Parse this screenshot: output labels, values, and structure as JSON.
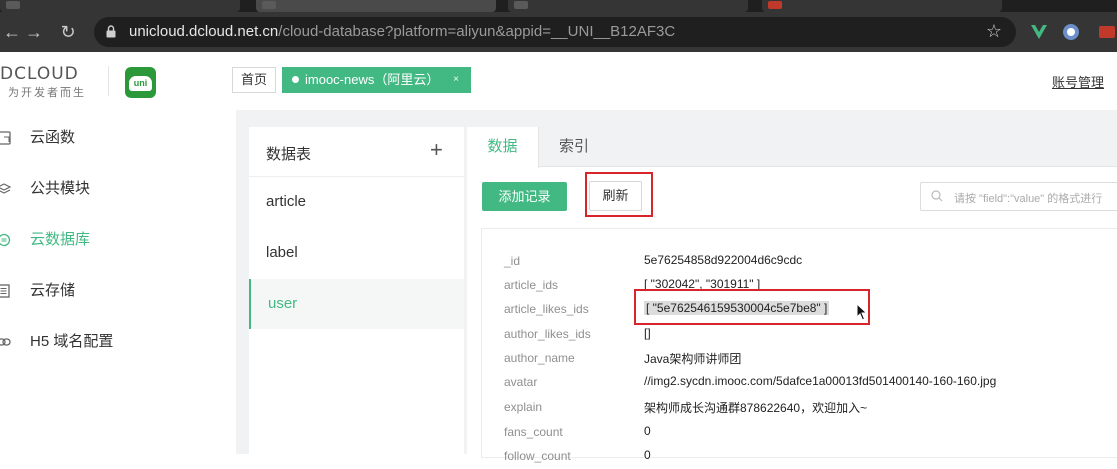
{
  "browser": {
    "url_host": "unicloud.dcloud.net.cn",
    "url_path": "/cloud-database?platform=aliyun&appid=__UNI__B12AF3C"
  },
  "header": {
    "logo_text": "DCLOUD",
    "logo_tagline": "为开发者而生",
    "uni_logo_text": "uni",
    "home_label": "首页",
    "space_tab_label": "imooc-news（阿里云）",
    "space_tab_close": "×",
    "account_label": "账号管理"
  },
  "sidebar": {
    "items": [
      {
        "label": "云函数",
        "icon": "cloud-function-icon"
      },
      {
        "label": "公共模块",
        "icon": "layers-icon"
      },
      {
        "label": "云数据库",
        "icon": "database-icon",
        "active": true
      },
      {
        "label": "云存储",
        "icon": "storage-icon"
      },
      {
        "label": "H5 域名配置",
        "icon": "link-icon"
      }
    ]
  },
  "tables": {
    "title": "数据表",
    "add_symbol": "+",
    "items": [
      "article",
      "label",
      "user"
    ],
    "active": "user"
  },
  "content": {
    "tabs": [
      "数据",
      "索引"
    ],
    "active_tab": "数据",
    "add_button": "添加记录",
    "refresh_button": "刷新",
    "search_placeholder": "请按 \"field\":\"value\" 的格式进行"
  },
  "record": {
    "fields": [
      {
        "key": "_id",
        "value": "5e76254858d922004d6c9cdc"
      },
      {
        "key": "article_ids",
        "value": "[ \"302042\", \"301911\" ]"
      },
      {
        "key": "article_likes_ids",
        "value": "[ \"5e762546159530004c5e7be8\" ]"
      },
      {
        "key": "author_likes_ids",
        "value": "[]"
      },
      {
        "key": "author_name",
        "value": "Java架构师讲师团"
      },
      {
        "key": "avatar",
        "value": "//img2.sycdn.imooc.com/5dafce1a00013fd501400140-160-160.jpg"
      },
      {
        "key": "explain",
        "value": "架构师成长沟通群878622640，欢迎加入~"
      },
      {
        "key": "fans_count",
        "value": "0"
      },
      {
        "key": "follow_count",
        "value": "0"
      }
    ]
  },
  "colors": {
    "brand_green": "#42b983",
    "highlight_red": "#d9242b"
  }
}
